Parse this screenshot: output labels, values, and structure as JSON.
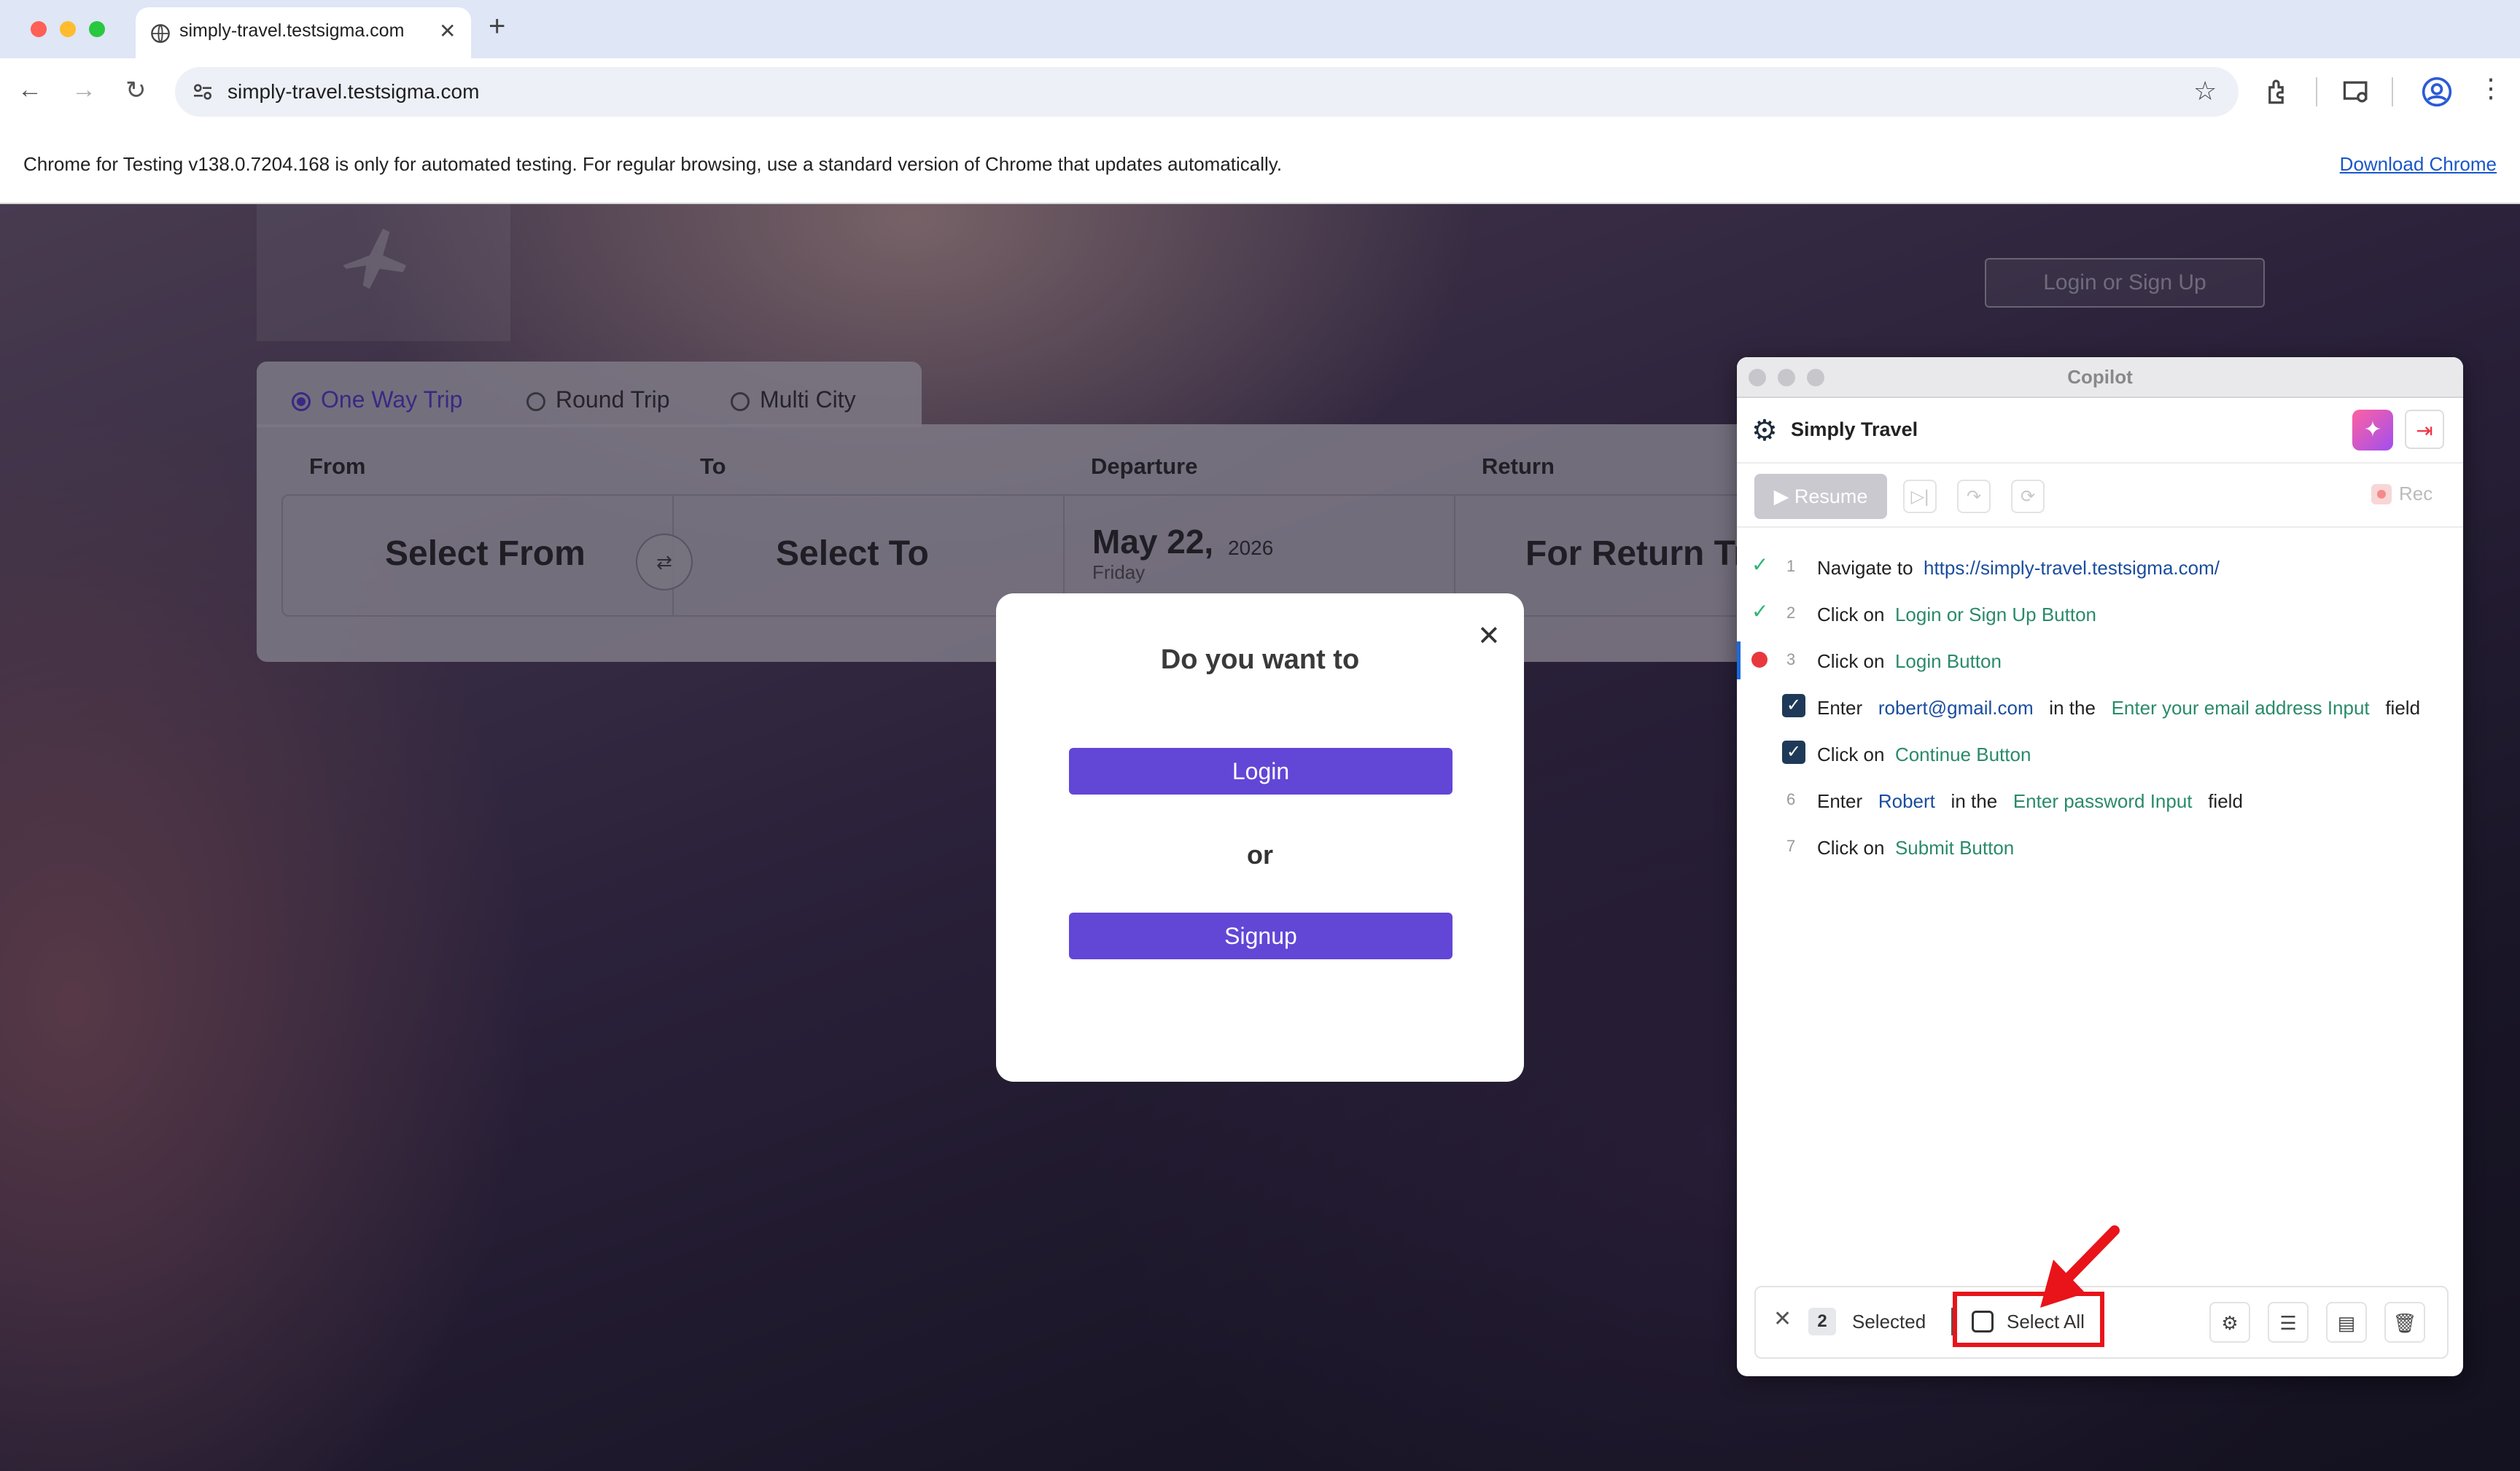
{
  "browser": {
    "tab_title": "simply-travel.testsigma.com",
    "tab_close": "✕",
    "new_tab": "+",
    "url": "simply-travel.testsigma.com",
    "info_message": "Chrome for Testing v138.0.7204.168 is only for automated testing. For regular browsing, use a standard version of Chrome that updates automatically.",
    "download_link": "Download Chrome"
  },
  "site": {
    "login_signup_button": "Login or Sign Up",
    "trip_types": [
      "One Way Trip",
      "Round Trip",
      "Multi City"
    ],
    "selected_trip": "One Way Trip",
    "columns": {
      "from": "From",
      "to": "To",
      "departure": "Departure",
      "return": "Return"
    },
    "from_field": "Select From",
    "to_field": "Select To",
    "departure_date": "May 22,",
    "departure_year": "2026",
    "departure_day": "Friday",
    "return_field": "For Return Tr"
  },
  "modal": {
    "title": "Do you want to",
    "login_button": "Login",
    "or_text": "or",
    "signup_button": "Signup",
    "close": "✕"
  },
  "copilot": {
    "window_title": "Copilot",
    "app_name": "Simply Travel",
    "resume_label": "Resume",
    "rec_label": "Rec",
    "steps": [
      {
        "num": "1",
        "status": "done",
        "parts": [
          "Navigate to",
          "https://simply-travel.testsigma.com/"
        ]
      },
      {
        "num": "2",
        "status": "done",
        "parts": [
          "Click on",
          "Login or Sign Up Button"
        ]
      },
      {
        "num": "3",
        "status": "error",
        "parts": [
          "Click on",
          "Login Button"
        ]
      },
      {
        "num": "",
        "status": "checked",
        "parts": [
          "Enter",
          "robert@gmail.com",
          "in the",
          "Enter your email address Input",
          "field"
        ]
      },
      {
        "num": "",
        "status": "checked",
        "parts": [
          "Click on",
          "Continue Button"
        ]
      },
      {
        "num": "6",
        "status": "",
        "parts": [
          "Enter",
          "Robert",
          "in the",
          "Enter password Input",
          "field"
        ]
      },
      {
        "num": "7",
        "status": "",
        "parts": [
          "Click on",
          "Submit Button"
        ]
      }
    ],
    "footer": {
      "selected_count": "2",
      "selected_label": "Selected",
      "select_all_label": "Select All"
    }
  },
  "colors": {
    "accent": "#6246d6",
    "highlight": "#e8141a",
    "success": "#2bb673",
    "error": "#e8383d"
  }
}
